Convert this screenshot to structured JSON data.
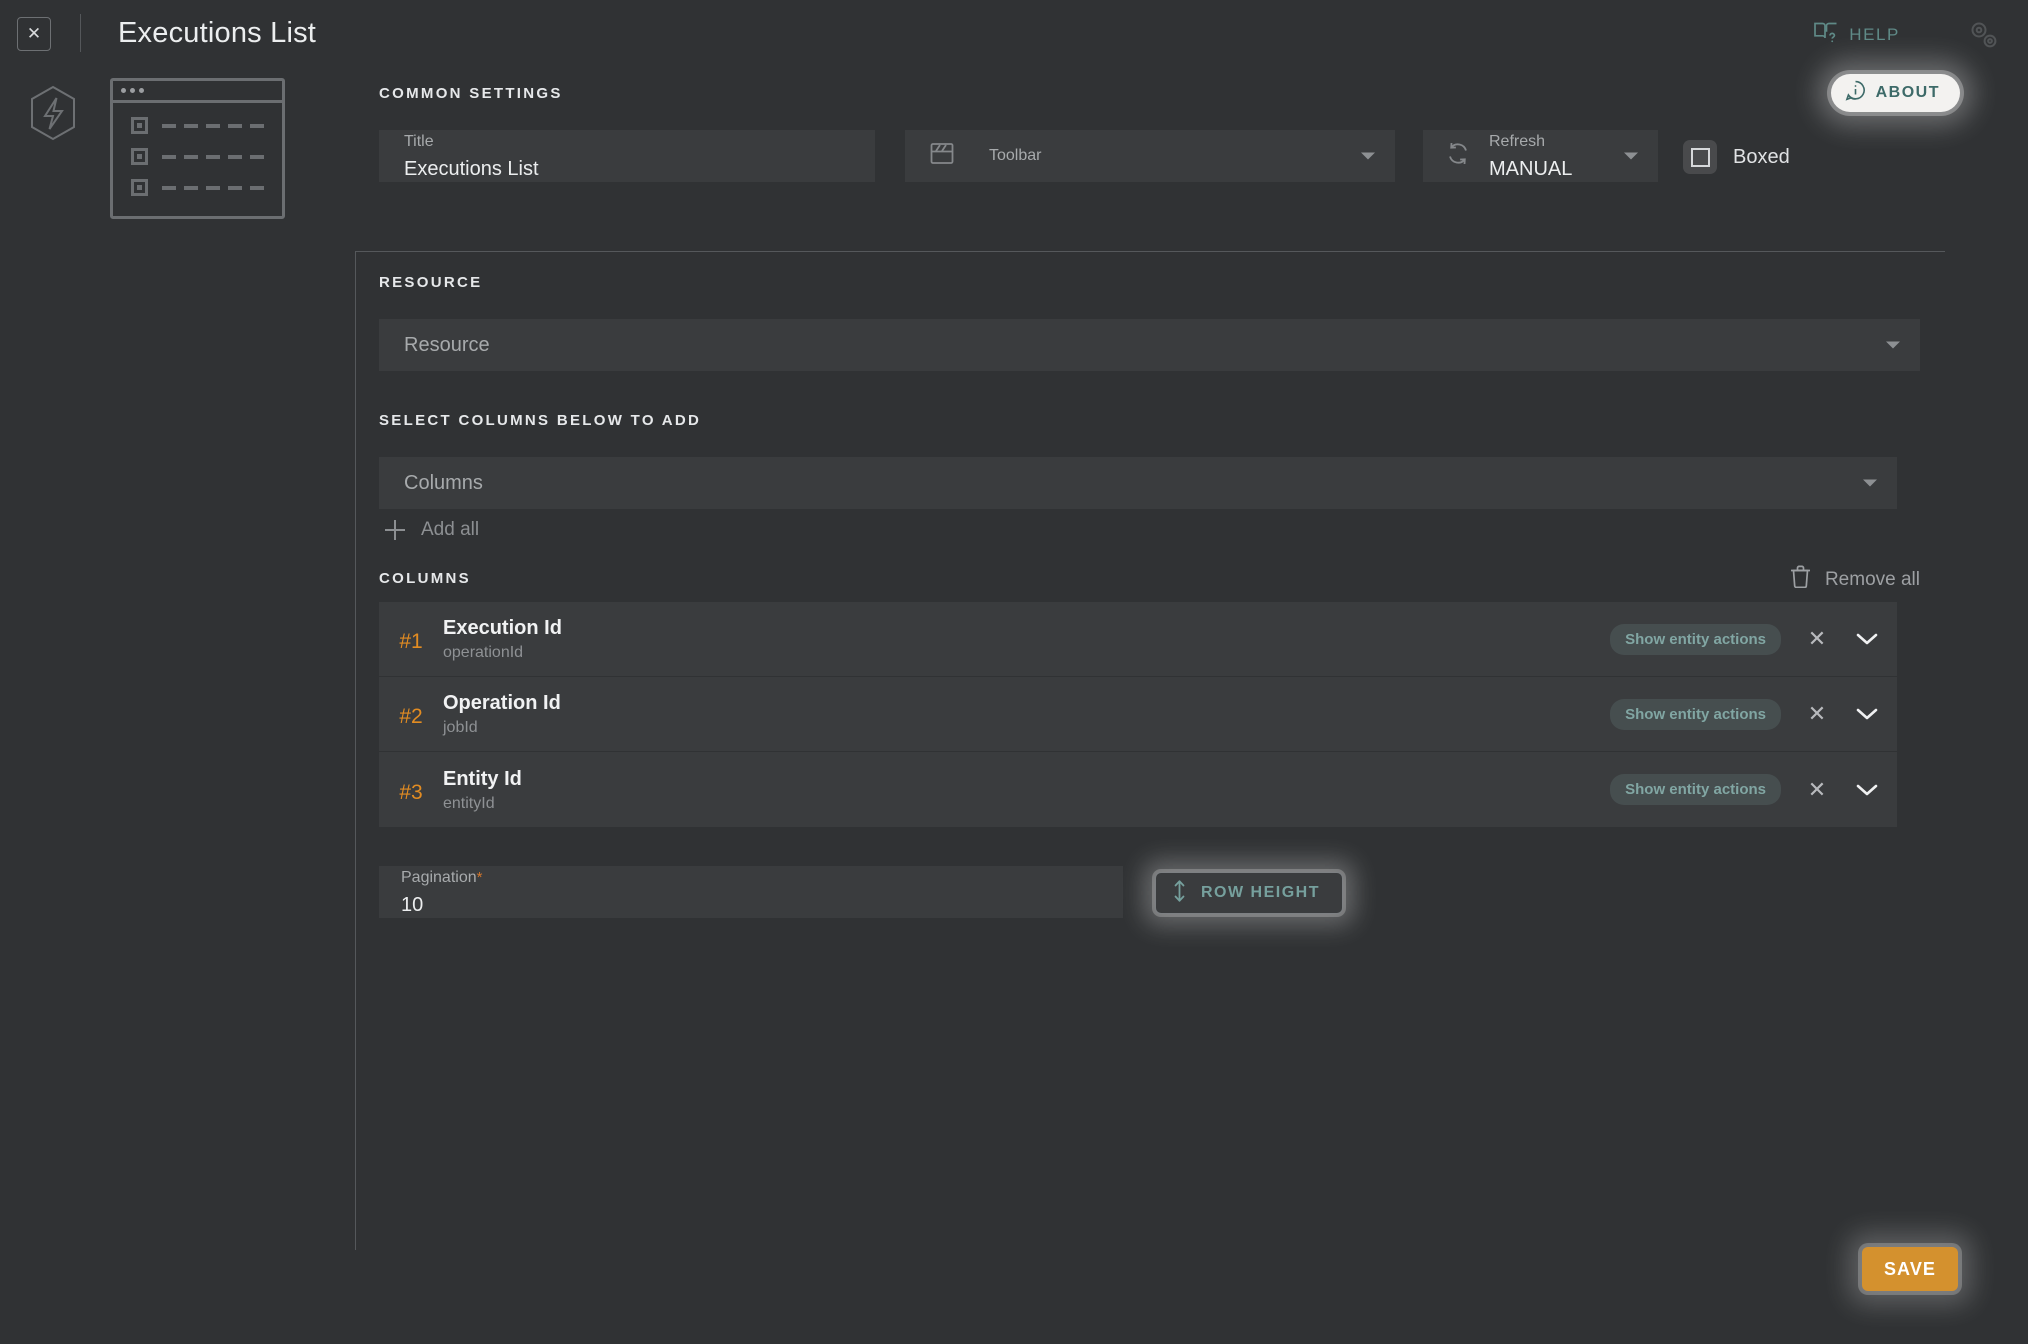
{
  "window": {
    "title": "Executions List",
    "close_label": "✕"
  },
  "topbar": {
    "help_label": "HELP",
    "about_label": "ABOUT"
  },
  "common_settings": {
    "heading": "COMMON SETTINGS",
    "title_field": {
      "label": "Title",
      "value": "Executions List"
    },
    "toolbar_field": {
      "label": "Toolbar",
      "value": ""
    },
    "refresh_field": {
      "label": "Refresh",
      "value": "MANUAL"
    },
    "boxed": {
      "label": "Boxed",
      "checked": false
    }
  },
  "resource": {
    "heading": "RESOURCE",
    "placeholder": "Resource"
  },
  "select_columns": {
    "heading": "SELECT COLUMNS BELOW TO ADD",
    "placeholder": "Columns",
    "add_all_label": "Add all"
  },
  "columns": {
    "heading": "COLUMNS",
    "remove_all_label": "Remove all",
    "badge_label": "Show entity actions",
    "items": [
      {
        "rank": "#1",
        "name": "Execution Id",
        "field": "operationId",
        "badge": "Show entity actions"
      },
      {
        "rank": "#2",
        "name": "Operation Id",
        "field": "jobId",
        "badge": "Show entity actions"
      },
      {
        "rank": "#3",
        "name": "Entity Id",
        "field": "entityId",
        "badge": "Show entity actions"
      }
    ]
  },
  "pagination": {
    "label": "Pagination",
    "required_marker": "*",
    "value": "10"
  },
  "row_height": {
    "label": "ROW HEIGHT"
  },
  "save": {
    "label": "SAVE"
  },
  "colors": {
    "background": "#303234",
    "field": "#3a3c3e",
    "accent_orange": "#e28c22",
    "accent_teal": "#5f8a87",
    "save_orange": "#d4912e",
    "text_primary": "#eceeef",
    "text_muted": "#8e9194"
  }
}
